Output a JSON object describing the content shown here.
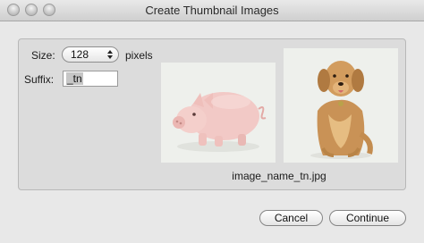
{
  "window": {
    "title": "Create Thumbnail Images"
  },
  "settings": {
    "size_label": "Size:",
    "size_value": "128",
    "size_unit": "pixels",
    "suffix_label": "Suffix:",
    "suffix_value": "_tn"
  },
  "preview": {
    "filename": "image_name_tn.jpg",
    "images": [
      "pig-thumbnail",
      "dog-thumbnail"
    ]
  },
  "buttons": {
    "cancel": "Cancel",
    "continue": "Continue"
  }
}
